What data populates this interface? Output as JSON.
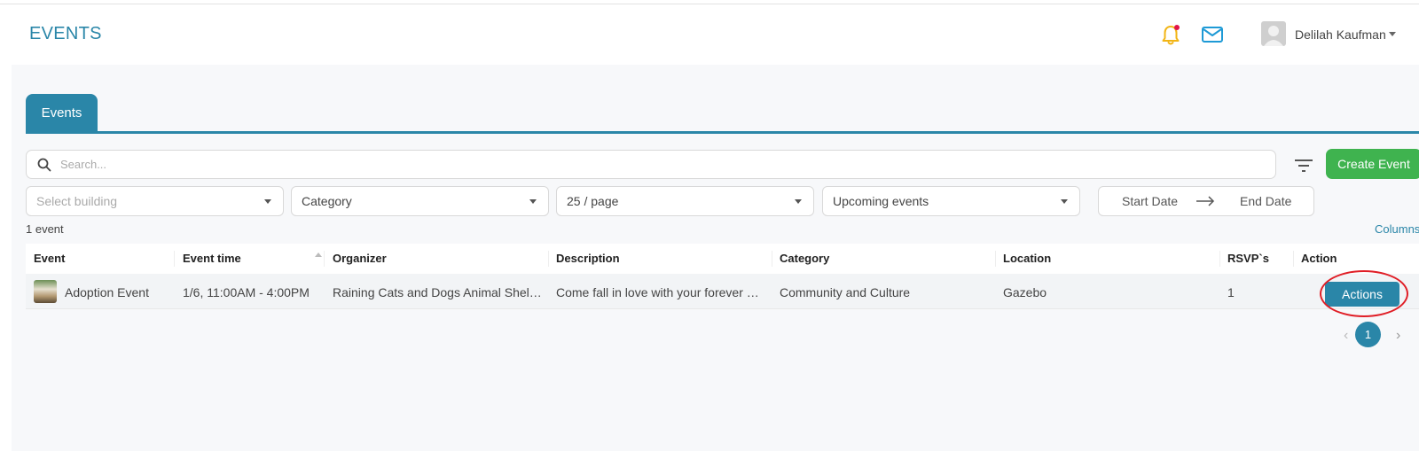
{
  "header": {
    "title": "EVENTS",
    "user_name": "Delilah Kaufman",
    "accent_color": "#2a86a8",
    "notification_dot_color": "#e0134a"
  },
  "tabs": [
    {
      "label": "Events",
      "active": true
    }
  ],
  "toolbar": {
    "search_placeholder": "Search...",
    "create_button": "Create Event",
    "create_button_color": "#3fb34f"
  },
  "filters": {
    "building": {
      "placeholder": "Select building"
    },
    "category": {
      "value": "Category"
    },
    "page_size": {
      "value": "25 / page"
    },
    "time_range": {
      "value": "Upcoming events"
    },
    "date_range": {
      "start_placeholder": "Start Date",
      "end_placeholder": "End Date"
    }
  },
  "summary": {
    "count_text": "1 event",
    "columns_link": "Columns"
  },
  "table": {
    "columns": [
      "Event",
      "Event time",
      "Organizer",
      "Description",
      "Category",
      "Location",
      "RSVP`s",
      "Action"
    ],
    "rows": [
      {
        "event": "Adoption Event",
        "event_time": "1/6, 11:00AM - 4:00PM",
        "organizer": "Raining Cats and Dogs Animal Shelter",
        "description": "Come fall in love with your forever best friend",
        "category": "Community and Culture",
        "location": "Gazebo",
        "rsvps": "1",
        "action_label": "Actions"
      }
    ]
  },
  "pagination": {
    "current": "1",
    "prev": "‹",
    "next": "›"
  },
  "annotation": {
    "highlight_color": "#e01e26"
  }
}
